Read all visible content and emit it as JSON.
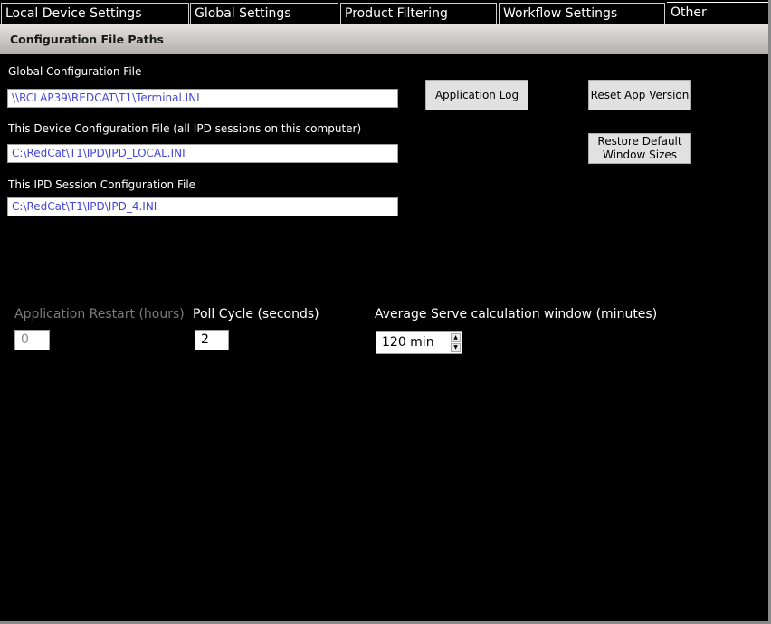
{
  "tabs": [
    {
      "label": "Local Device Settings",
      "active": false
    },
    {
      "label": "Global Settings",
      "active": false
    },
    {
      "label": "Product Filtering",
      "active": false
    },
    {
      "label": "Workflow Settings",
      "active": false
    },
    {
      "label": "Other",
      "active": true
    }
  ],
  "section": {
    "title": "Configuration File Paths"
  },
  "config_files": {
    "global": {
      "label": "Global Configuration File",
      "value": "\\\\RCLAP39\\REDCAT\\T1\\Terminal.INI"
    },
    "device": {
      "label": "This Device Configuration File (all IPD sessions on this computer)",
      "value": "C:\\RedCat\\T1\\IPD\\IPD_LOCAL.INI"
    },
    "session": {
      "label": "This IPD Session Configuration File",
      "value": "C:\\RedCat\\T1\\IPD\\IPD_4.INI"
    }
  },
  "buttons": {
    "application_log": "Application Log",
    "reset_app_version": "Reset App Version",
    "restore_default_line1": "Restore Default",
    "restore_default_line2": "Window Sizes"
  },
  "settings": {
    "app_restart": {
      "label": "Application Restart  (hours)",
      "value": "0",
      "disabled": true
    },
    "poll_cycle": {
      "label": "Poll Cycle (seconds)",
      "value": "2"
    },
    "avg_serve": {
      "label": "Average Serve calculation window (minutes)",
      "value": "120 min",
      "up_icon": "▲",
      "down_icon": "▼"
    }
  }
}
